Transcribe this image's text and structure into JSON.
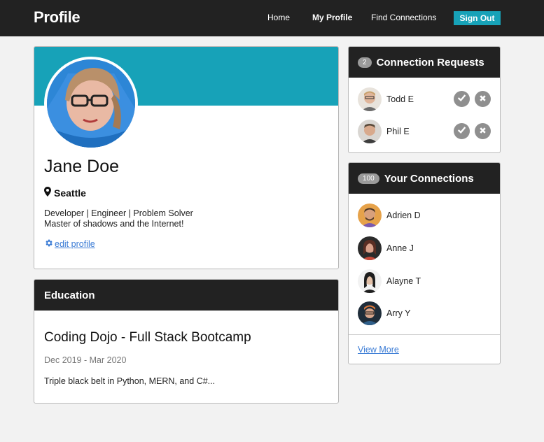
{
  "header": {
    "title": "Profile",
    "nav": {
      "home": "Home",
      "my_profile": "My Profile",
      "find": "Find Connections"
    },
    "signout": "Sign Out",
    "colors": {
      "bar": "#222222",
      "accent": "#17a2b8"
    }
  },
  "profile": {
    "name": "Jane Doe",
    "location": "Seattle",
    "bio_line1": "Developer | Engineer | Problem Solver",
    "bio_line2": "Master of shadows and the Internet!",
    "edit_label": " edit profile",
    "location_icon": "map-marker-icon",
    "edit_icon": "gear-icon"
  },
  "education": {
    "heading": "Education",
    "title": "Coding Dojo - Full Stack Bootcamp",
    "dates": "Dec 2019 - Mar 2020",
    "description": "Triple black belt in Python, MERN, and C#..."
  },
  "requests": {
    "count": "2",
    "heading": "Connection Requests",
    "people": [
      {
        "name": "Todd E"
      },
      {
        "name": "Phil E"
      }
    ]
  },
  "connections": {
    "count": "100",
    "heading": "Your Connections",
    "people": [
      {
        "name": "Adrien D"
      },
      {
        "name": "Anne J"
      },
      {
        "name": "Alayne T"
      },
      {
        "name": "Arry Y"
      }
    ],
    "view_more": "View More"
  }
}
